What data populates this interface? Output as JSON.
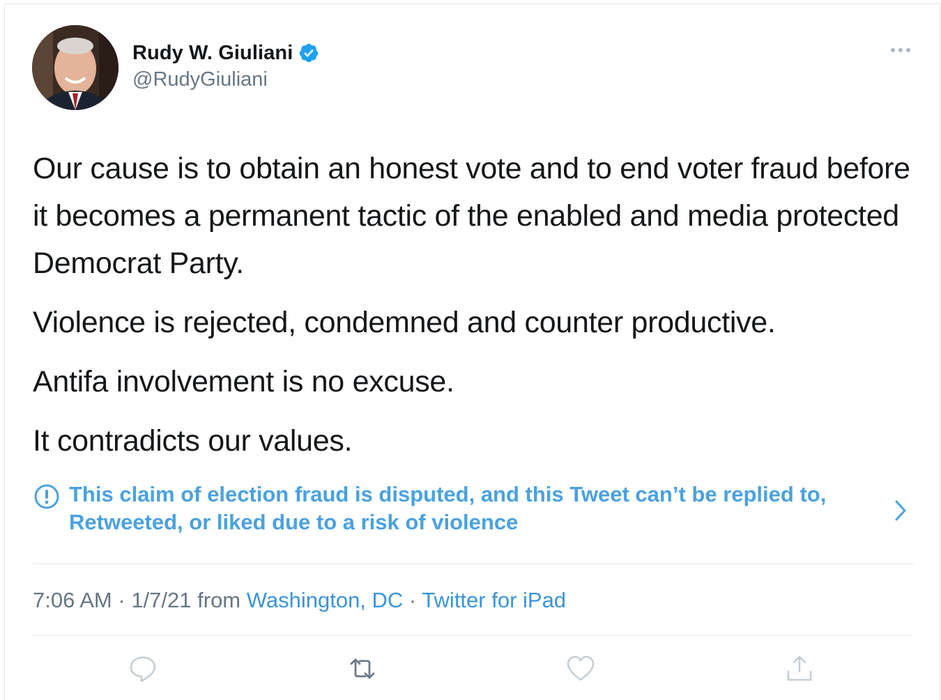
{
  "author": {
    "name": "Rudy W. Giuliani",
    "handle": "@RudyGiuliani",
    "verified": true,
    "avatar_icon": "profile-photo"
  },
  "tweet": {
    "paragraphs": [
      "Our cause is to obtain an honest vote and to end voter fraud before it becomes a permanent tactic of the enabled and media protected Democrat Party.",
      "Violence is rejected, condemned and counter productive.",
      "Antifa involvement is no excuse.",
      "It contradicts our values."
    ]
  },
  "notice": {
    "icon": "exclamation-circle-icon",
    "line1": "This claim of election fraud is disputed, and this Tweet can’t be replied to,",
    "line2": "Retweeted, or liked due to a risk of violence"
  },
  "meta": {
    "time": "7:06 AM",
    "sep1": " · ",
    "date": "1/7/21",
    "from_label": " from ",
    "location": "Washington, DC",
    "sep2": " · ",
    "source": "Twitter for iPad"
  },
  "actions": [
    "reply-icon",
    "retweet-icon",
    "like-icon",
    "share-icon"
  ],
  "colors": {
    "text": "#14171a",
    "secondary": "#657786",
    "link": "#3b94d9",
    "notice": "#4aa1e0",
    "verified": "#1da1f2",
    "action_icon": "#c5ced6"
  }
}
